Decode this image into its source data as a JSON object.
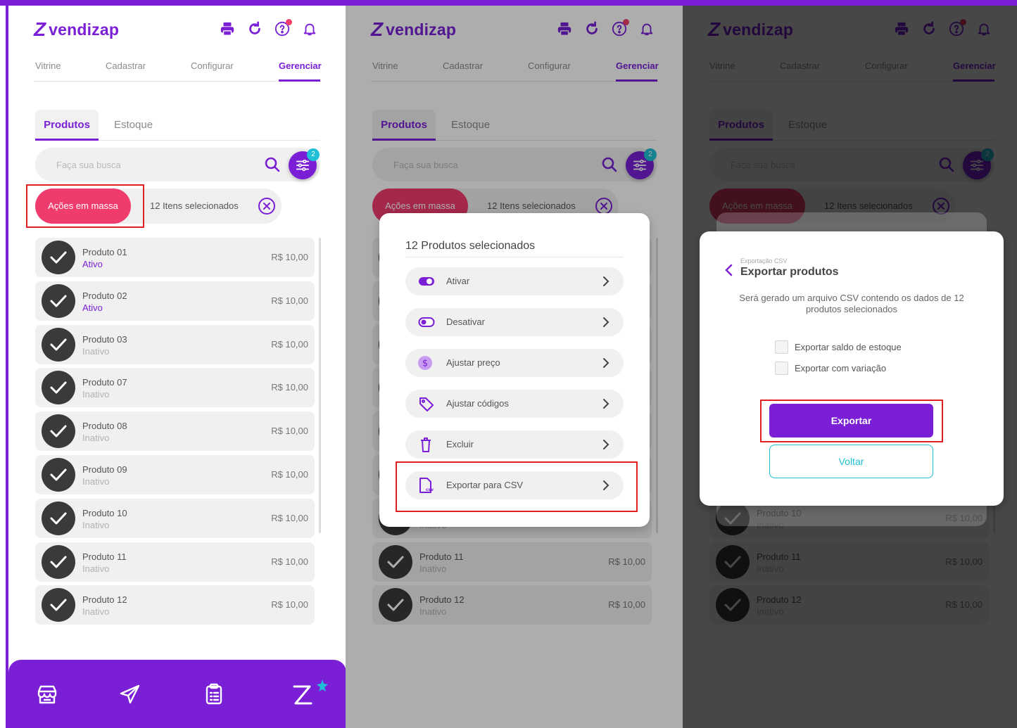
{
  "brand": {
    "name": "vendizap",
    "logo_letter": "Z",
    "color_primary": "#7a1fd6",
    "color_accent": "#f03b6d",
    "color_secondary": "#1fc0d7"
  },
  "header": {
    "icons": [
      "printer-icon",
      "refresh-icon",
      "help-icon",
      "bell-icon"
    ]
  },
  "nav": {
    "items": [
      "Vitrine",
      "Cadastrar",
      "Configurar",
      "Gerenciar"
    ],
    "active": "Gerenciar"
  },
  "subtabs": {
    "items": [
      "Produtos",
      "Estoque"
    ],
    "active": "Produtos"
  },
  "search": {
    "placeholder": "Faça sua busca",
    "filter_count": "2"
  },
  "mass": {
    "button_label": "Ações em massa",
    "selected_text": "12 Itens selecionados"
  },
  "products": [
    {
      "name": "Produto 01",
      "status": "Ativo",
      "price": "R$ 10,00"
    },
    {
      "name": "Produto 02",
      "status": "Ativo",
      "price": "R$ 10,00"
    },
    {
      "name": "Produto 03",
      "status": "Inativo",
      "price": "R$ 10,00"
    },
    {
      "name": "Produto 07",
      "status": "Inativo",
      "price": "R$ 10,00"
    },
    {
      "name": "Produto 08",
      "status": "Inativo",
      "price": "R$ 10,00"
    },
    {
      "name": "Produto 09",
      "status": "Inativo",
      "price": "R$ 10,00"
    },
    {
      "name": "Produto 10",
      "status": "Inativo",
      "price": "R$ 10,00"
    },
    {
      "name": "Produto 11",
      "status": "Inativo",
      "price": "R$ 10,00"
    },
    {
      "name": "Produto 12",
      "status": "Inativo",
      "price": "R$ 10,00"
    }
  ],
  "bottom_bar": {
    "icons": [
      "store-icon",
      "send-icon",
      "clipboard-icon",
      "vendizap-star-icon"
    ]
  },
  "bulk_modal": {
    "title": "12 Produtos selecionados",
    "actions": [
      "Ativar",
      "Desativar",
      "Ajustar preço",
      "Ajustar códigos",
      "Excluir",
      "Exportar para CSV"
    ]
  },
  "export_modal": {
    "breadcrumb": "Exportação CSV",
    "title": "Exportar produtos",
    "description": "Será gerado um arquivo CSV contendo os dados de 12 produtos selecionados",
    "options": [
      "Exportar saldo de estoque",
      "Exportar com variação"
    ],
    "primary_label": "Exportar",
    "secondary_label": "Voltar"
  }
}
